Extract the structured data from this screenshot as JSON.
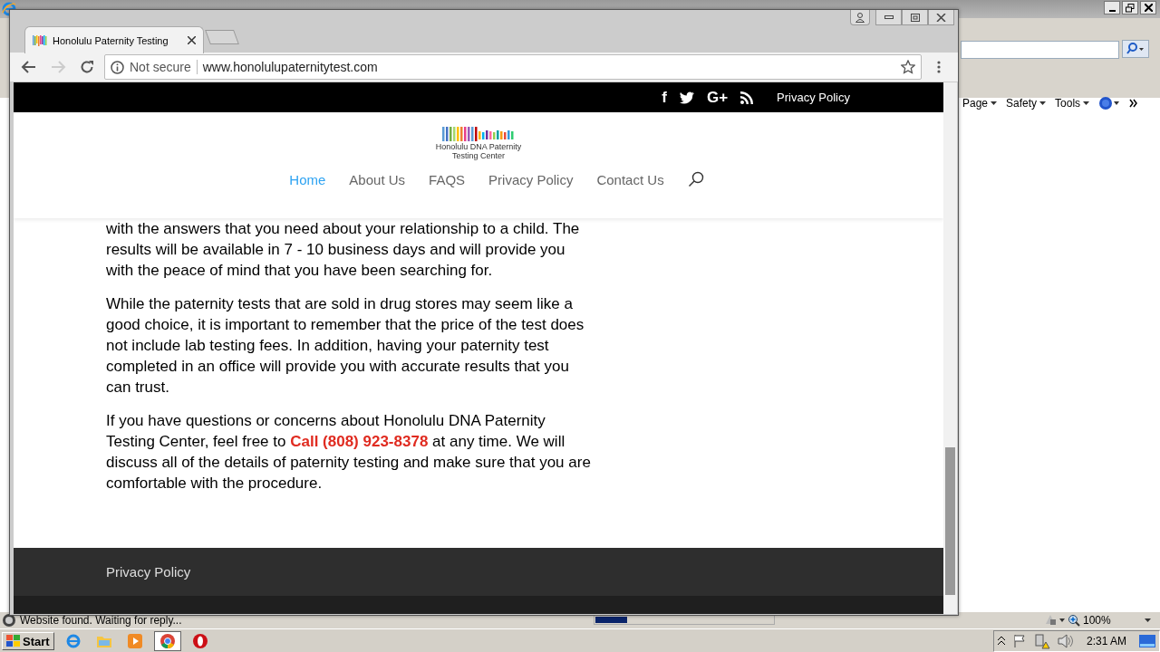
{
  "ie_window": {
    "command_bar": [
      {
        "label": "Page"
      },
      {
        "label": "Safety"
      },
      {
        "label": "Tools"
      }
    ],
    "status_text": "Website found. Waiting for reply...",
    "progress": {
      "level": 0.18
    },
    "zoom": "100%"
  },
  "browser": {
    "tab_title": "Honolulu Paternity Testing",
    "security": "Not secure",
    "url": "www.honolulupaternitytest.com"
  },
  "site": {
    "top_bar": {
      "social": [
        {
          "kind": "facebook",
          "glyph": "f"
        },
        {
          "kind": "twitter"
        },
        {
          "kind": "googleplus",
          "glyph": "G+"
        },
        {
          "kind": "rss"
        }
      ],
      "link": "Privacy Policy"
    },
    "logo": {
      "line_1": "Honolulu DNA Paternity",
      "line_2": "Testing Center"
    },
    "nav": [
      {
        "label": "Home",
        "selected": true
      },
      {
        "label": "About Us",
        "selected": false
      },
      {
        "label": "FAQS",
        "selected": false
      },
      {
        "label": "Privacy Policy",
        "selected": false
      },
      {
        "label": "Contact Us",
        "selected": false
      }
    ],
    "paragraphs": [
      {
        "text": "with the answers that you need about your relationship to a child. The results will be available in 7 - 10 business days and will provide you with the peace of mind that you have been searching for."
      },
      {
        "text": "While the paternity tests that are sold in drug stores may seem like a good choice, it is important to remember that the price of the test does not include lab testing fees. In addition, having your paternity test completed in an office will provide you with accurate results that you can trust."
      },
      {
        "text": "If you have questions or concerns about Honolulu DNA Paternity Testing Center, feel free to",
        "link": "Call (808) 923-8378",
        "text_after": "at any time. We will discuss all of the details of paternity testing and make sure that you are comfortable with the procedure."
      }
    ],
    "footer": {
      "link": "Privacy Policy"
    }
  },
  "taskbar": {
    "start": "Start",
    "time": "2:31 AM"
  }
}
